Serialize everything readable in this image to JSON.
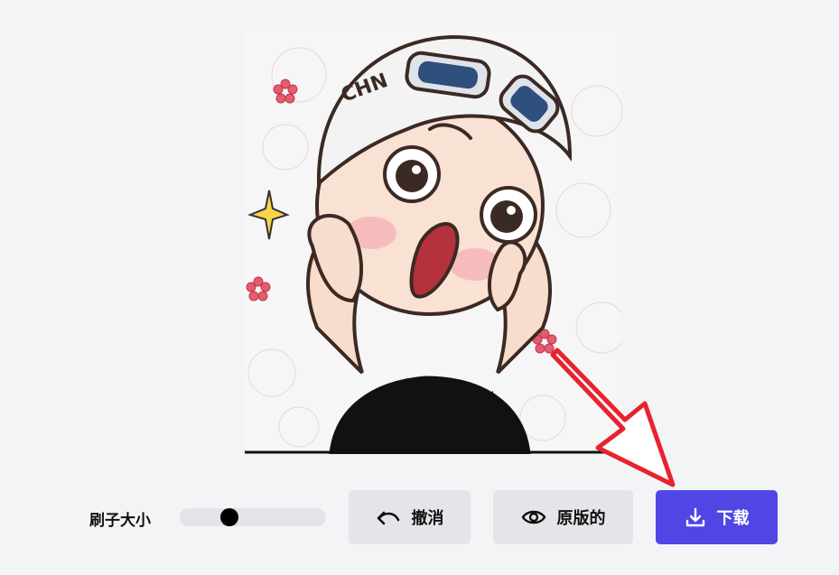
{
  "image": {
    "cap_text": "CHN"
  },
  "controls": {
    "brush_size_label": "刷子大小",
    "brush_size_fraction": 0.32,
    "undo_label": "撤消",
    "original_label": "原版的",
    "download_label": "下载"
  },
  "colors": {
    "primary": "#4f46e5",
    "annotation_arrow": "#e8222e"
  },
  "icons": {
    "undo": "undo-icon",
    "original": "eye-icon",
    "download": "download-icon"
  }
}
